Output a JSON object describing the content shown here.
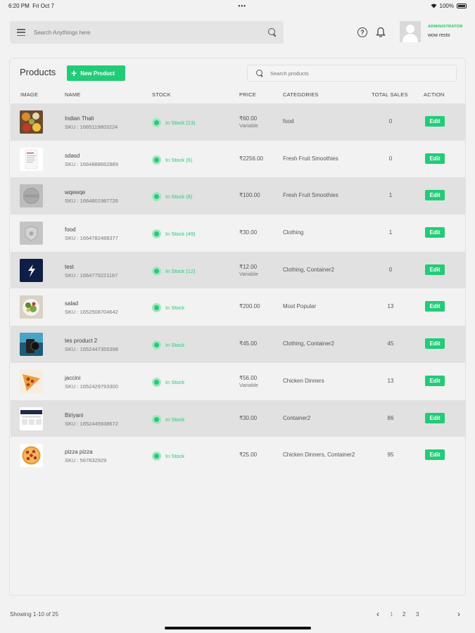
{
  "status_bar": {
    "time": "6:20 PM",
    "date": "Fri Oct 7",
    "dots": "•••",
    "battery": "100%"
  },
  "topbar": {
    "search_placeholder": "Search Anythings here"
  },
  "user": {
    "role": "ADMINISTRATOR",
    "name": "wow resto"
  },
  "products": {
    "title": "Products",
    "new_button": "New Product",
    "search_placeholder": "Search products",
    "columns": {
      "image": "IMAGE",
      "name": "NAME",
      "stock": "STOCK",
      "price": "PRICE",
      "categories": "CATEGORIES",
      "total_sales": "TOTAL SALES",
      "action": "ACTION"
    },
    "rows": [
      {
        "name": "Indian Thali",
        "sku": "SKU : 1665119803224",
        "stock": "In Stock (13)",
        "price": "₹60.00",
        "price_type": "Variable",
        "categories": "food",
        "sales": "0",
        "action": "Edit",
        "image": "thali-photo"
      },
      {
        "name": "sdasd",
        "sku": "SKU : 1664888662889",
        "stock": "In Stock (6)",
        "price": "₹2256.00",
        "price_type": "",
        "categories": "Fresh Fruit Smoothies",
        "sales": "0",
        "action": "Edit",
        "image": "document-photo"
      },
      {
        "name": "wqewqe",
        "sku": "SKU : 1664801987726",
        "stock": "In Stock (8)",
        "price": "₹100.00",
        "price_type": "",
        "categories": "Fresh Fruit Smoothies",
        "sales": "1",
        "action": "Edit",
        "image": "placeholder-logo"
      },
      {
        "name": "food",
        "sku": "SKU : 1664782488377",
        "stock": "In Stock (49)",
        "price": "₹30.00",
        "price_type": "",
        "categories": "Clothing",
        "sales": "1",
        "action": "Edit",
        "image": "placeholder-shield"
      },
      {
        "name": "test",
        "sku": "SKU : 1664775221167",
        "stock": "In Stock (12)",
        "price": "₹12.00",
        "price_type": "Variable",
        "categories": "Clothing, Container2",
        "sales": "0",
        "action": "Edit",
        "image": "app-logo"
      },
      {
        "name": "salad",
        "sku": "SKU : 1652508704642",
        "stock": "In Stock",
        "price": "₹200.00",
        "price_type": "",
        "categories": "Most Popular",
        "sales": "13",
        "action": "Edit",
        "image": "salad-photo"
      },
      {
        "name": "tes product 2",
        "sku": "SKU : 1652447355398",
        "stock": "In Stock",
        "price": "₹45.00",
        "price_type": "",
        "categories": "Clothing, Container2",
        "sales": "45",
        "action": "Edit",
        "image": "gadget-photo"
      },
      {
        "name": "jaccini",
        "sku": "SKU : 1652429793300",
        "stock": "In Stock",
        "price": "₹56.00",
        "price_type": "Variable",
        "categories": "Chicken Dinners",
        "sales": "13",
        "action": "Edit",
        "image": "pizza-slice-photo"
      },
      {
        "name": "Biriyani",
        "sku": "SKU : 1652445938672",
        "stock": "In Stock",
        "price": "₹30.00",
        "price_type": "",
        "categories": "Container2",
        "sales": "86",
        "action": "Edit",
        "image": "screenshot-photo"
      },
      {
        "name": "pizza pizza",
        "sku": "SKU : 567832929",
        "stock": "In Stock",
        "price": "₹25.00",
        "price_type": "",
        "categories": "Chicken Dinners, Container2",
        "sales": "95",
        "action": "Edit",
        "image": "pizza-photo"
      }
    ]
  },
  "footer": {
    "showing": "Showing 1-10 of 25",
    "pages": [
      "1",
      "2",
      "3"
    ],
    "active_page": "1",
    "prev": "‹",
    "next": "›"
  },
  "colors": {
    "accent": "#22cc77",
    "row_shade": "#e1e1e1"
  }
}
